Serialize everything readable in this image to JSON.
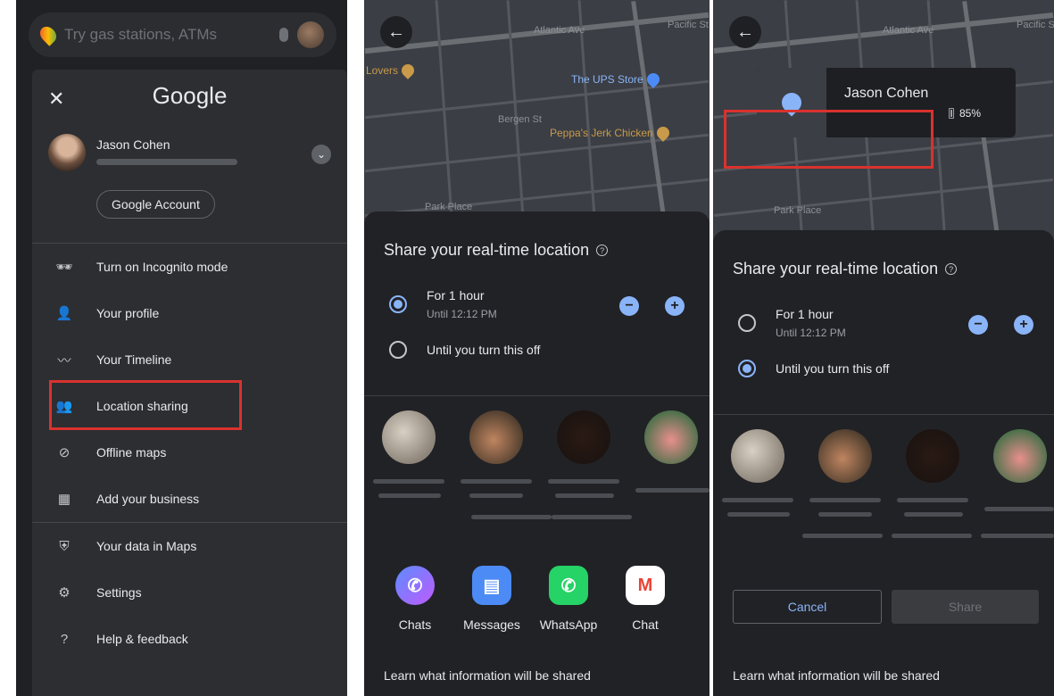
{
  "panel1": {
    "search_placeholder": "Try gas stations, ATMs",
    "logo": "Google",
    "account": {
      "name": "Jason Cohen",
      "google_account_button": "Google Account"
    },
    "menu_items": [
      {
        "label": "Turn on Incognito mode",
        "icon": "incognito-icon"
      },
      {
        "label": "Your profile",
        "icon": "person-icon"
      },
      {
        "label": "Your Timeline",
        "icon": "timeline-icon"
      },
      {
        "label": "Location sharing",
        "icon": "location-sharing-icon"
      },
      {
        "label": "Offline maps",
        "icon": "offline-icon"
      },
      {
        "label": "Add your business",
        "icon": "store-icon"
      },
      {
        "label": "Your data in Maps",
        "icon": "shield-icon"
      },
      {
        "label": "Settings",
        "icon": "gear-icon"
      },
      {
        "label": "Help & feedback",
        "icon": "help-icon"
      }
    ]
  },
  "map": {
    "streets": [
      "Atlantic Ave",
      "Pacific St",
      "Bergen St"
    ],
    "pois": [
      "Lovers",
      "The UPS Store",
      "Peppa's Jerk Chicken"
    ],
    "transit": "Park Place"
  },
  "share_sheet": {
    "title": "Share your real-time location",
    "option_hour": "For 1 hour",
    "option_hour_sub": "Until 12:12 PM",
    "option_until_off": "Until you turn this off",
    "apps": [
      {
        "label": "Chats",
        "color": "#7b61ff"
      },
      {
        "label": "Messages",
        "color": "#4c8bf5"
      },
      {
        "label": "WhatsApp",
        "color": "#25d366"
      },
      {
        "label": "Chat",
        "color": "#ffffff"
      }
    ],
    "learn": "Learn what information will be shared",
    "cancel": "Cancel",
    "share": "Share"
  },
  "person_card": {
    "name": "Jason Cohen",
    "battery": "85%"
  }
}
